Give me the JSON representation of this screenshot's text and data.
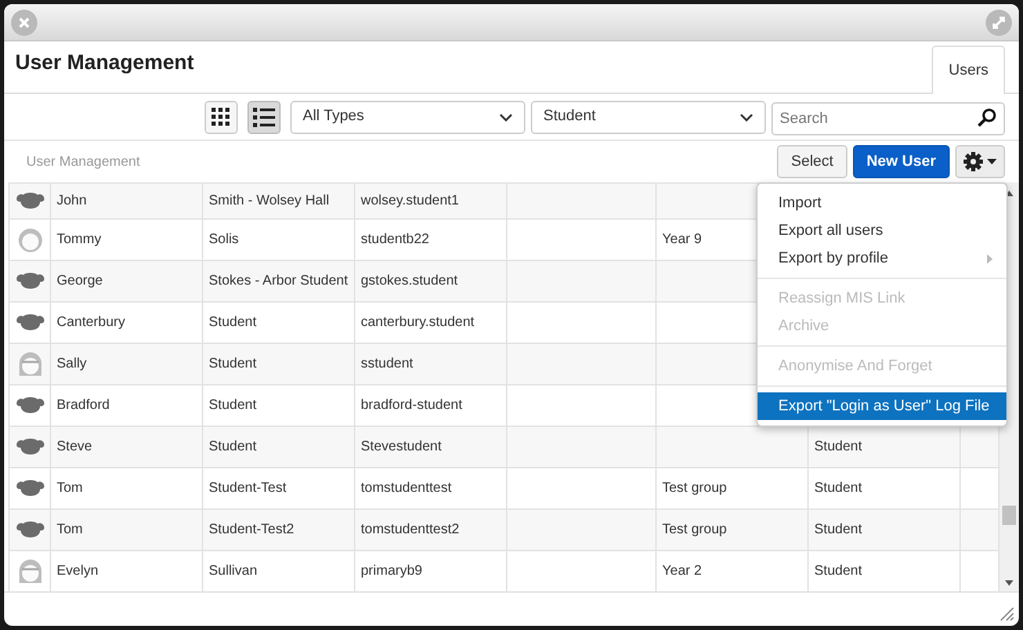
{
  "window": {
    "title": "User Management"
  },
  "tabs": [
    {
      "label": "Users",
      "selected": true
    }
  ],
  "view_toggle": [
    {
      "kind": "grid",
      "selected": false
    },
    {
      "kind": "list",
      "selected": true
    }
  ],
  "filters": [
    {
      "value": "All Types"
    },
    {
      "value": "Student"
    }
  ],
  "search": {
    "placeholder": "Search"
  },
  "breadcrumb": "User Management",
  "buttons": [
    {
      "label": "Select",
      "kind": "default"
    },
    {
      "label": "New User",
      "kind": "primary"
    }
  ],
  "rows": [
    {
      "kind": "generic",
      "column_2": "John",
      "column_3": "Smith - Wolsey Hall",
      "column_4": "wolsey.student1"
    },
    {
      "kind": "child",
      "column_2": "Tommy",
      "column_3": "Solis",
      "column_4": "studentb22",
      "column_6": "Year 9"
    },
    {
      "kind": "generic",
      "column_2": "George",
      "column_3": "Stokes - Arbor Student",
      "column_4": "gstokes.student"
    },
    {
      "kind": "generic",
      "column_2": "Canterbury",
      "column_3": "Student",
      "column_4": "canterbury.student"
    },
    {
      "kind": "girl",
      "column_2": "Sally",
      "column_3": "Student",
      "column_4": "sstudent"
    },
    {
      "kind": "generic",
      "column_2": "Bradford",
      "column_3": "Student",
      "column_4": "bradford-student"
    },
    {
      "kind": "generic",
      "column_2": "Steve",
      "column_3": "Student",
      "column_4": "Stevestudent",
      "column_7": "Student"
    },
    {
      "kind": "generic",
      "column_2": "Tom",
      "column_3": "Student-Test",
      "column_4": "tomstudenttest",
      "column_6": "Test group",
      "column_7": "Student"
    },
    {
      "kind": "generic",
      "column_2": "Tom",
      "column_3": "Student-Test2",
      "column_4": "tomstudenttest2",
      "column_6": "Test group",
      "column_7": "Student"
    },
    {
      "kind": "girl",
      "column_2": "Evelyn",
      "column_3": "Sullivan",
      "column_4": "primaryb9",
      "column_6": "Year 2",
      "column_7": "Student"
    }
  ],
  "menu": {
    "groups": [
      [
        {
          "label": "Import",
          "disabled": false,
          "selected": false,
          "submenu": false
        },
        {
          "label": "Export all users",
          "disabled": false,
          "selected": false,
          "submenu": false
        },
        {
          "label": "Export by profile",
          "disabled": false,
          "selected": false,
          "submenu": true
        }
      ],
      [
        {
          "label": "Reassign MIS Link",
          "disabled": true,
          "selected": false,
          "submenu": false
        },
        {
          "label": "Archive",
          "disabled": true,
          "selected": false,
          "submenu": false
        }
      ],
      [
        {
          "label": "Anonymise And Forget",
          "disabled": true,
          "selected": false,
          "submenu": false
        }
      ],
      [
        {
          "label": "Export \"Login as User\" Log File",
          "disabled": false,
          "selected": true,
          "submenu": false
        }
      ]
    ]
  }
}
